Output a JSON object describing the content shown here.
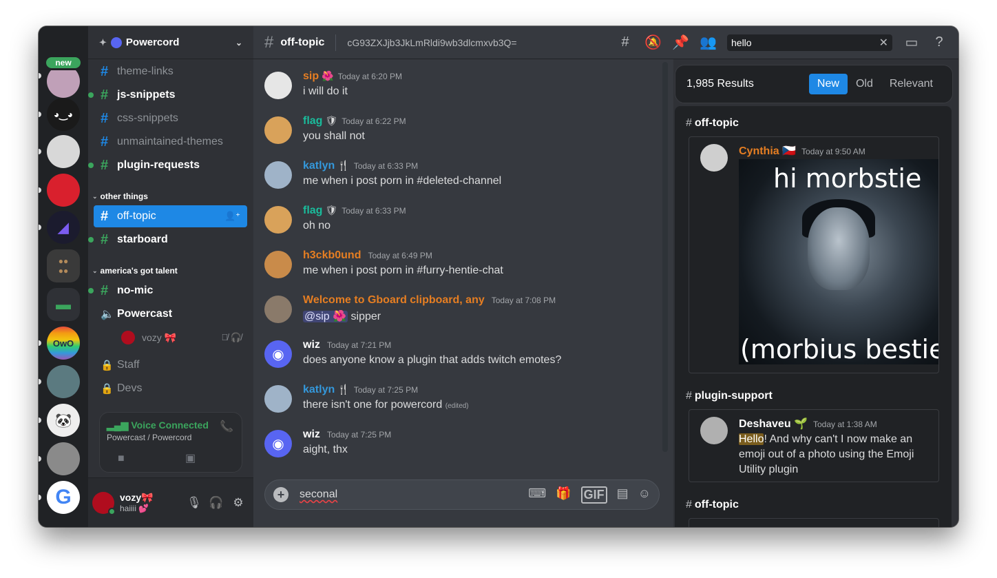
{
  "app": {
    "name": "Discord"
  },
  "guilds": {
    "new_badge": "new",
    "items": [
      {
        "name": "server-avatar-1",
        "color": "#c0a0b8"
      },
      {
        "name": "server-avatar-2",
        "color": "#1a1a1a"
      },
      {
        "name": "server-avatar-3",
        "color": "#d8d8d8"
      },
      {
        "name": "server-avatar-4",
        "color": "#d9202d"
      },
      {
        "name": "powercord-server",
        "color": "#1b1b2e"
      },
      {
        "name": "cookie-folder",
        "color": "#3a3a3a"
      },
      {
        "name": "green-folder",
        "color": "#2f3136"
      },
      {
        "name": "owo-server",
        "color": "#3ba55d"
      },
      {
        "name": "server-avatar-9",
        "color": "#5b7a80"
      },
      {
        "name": "panda-server",
        "color": "#eeeeee"
      },
      {
        "name": "grey-server",
        "color": "#8a8a8a"
      },
      {
        "name": "google-server",
        "color": "#ffffff"
      }
    ]
  },
  "server": {
    "name": "Powercord"
  },
  "channels": {
    "list": [
      {
        "name": "theme-links",
        "type": "text",
        "bright": false,
        "unread": false
      },
      {
        "name": "js-snippets",
        "type": "text",
        "bright": true,
        "unread": true
      },
      {
        "name": "css-snippets",
        "type": "text",
        "bright": false,
        "unread": false
      },
      {
        "name": "unmaintained-themes",
        "type": "text",
        "bright": false,
        "unread": false
      },
      {
        "name": "plugin-requests",
        "type": "text",
        "bright": true,
        "unread": true
      }
    ],
    "category_other": "other things",
    "other": [
      {
        "name": "off-topic",
        "type": "text",
        "active": true
      },
      {
        "name": "starboard",
        "type": "text",
        "bright": true,
        "unread": true
      }
    ],
    "category_agt": "america's got talent",
    "agt": [
      {
        "name": "no-mic",
        "type": "text",
        "bright": true,
        "unread": true
      },
      {
        "name": "Powercast",
        "type": "voice",
        "bright": true
      }
    ],
    "voice_user": "vozy 🎀",
    "locked": [
      {
        "name": "Staff",
        "type": "locked"
      },
      {
        "name": "Devs",
        "type": "locked"
      }
    ]
  },
  "voice_connected": {
    "title": "Voice Connected",
    "subtitle": "Powercast / Powercord"
  },
  "user": {
    "name": "vozy🎀",
    "status": "haiiii 💕"
  },
  "topbar": {
    "channel": "off-topic",
    "topic": "cG93ZXJjb3JkLmRldi9wb3dlcmxvb3Q=",
    "search_value": "hello"
  },
  "messages": [
    {
      "author": "sip",
      "badge": "🌺",
      "color": "#e67e22",
      "time": "Today at 6:20 PM",
      "text": "i will do it",
      "avatar": "#e6e6e6"
    },
    {
      "author": "flag",
      "badge": "🛡",
      "color": "#1abc9c",
      "time": "Today at 6:22 PM",
      "text": "you shall not",
      "avatar": "#d9a25a"
    },
    {
      "author": "katlyn",
      "badge": "🍴",
      "color": "#3498db",
      "time": "Today at 6:33 PM",
      "text": "me when i post porn in #deleted-channel",
      "avatar": "#9fb3c8"
    },
    {
      "author": "flag",
      "badge": "🛡",
      "color": "#1abc9c",
      "time": "Today at 6:33 PM",
      "text": "oh no",
      "avatar": "#d9a25a"
    },
    {
      "author": "h3ckb0und",
      "badge": "",
      "color": "#e67e22",
      "time": "Today at 6:49 PM",
      "text": "me when i post porn in #furry-hentie-chat",
      "avatar": "#c98b4a"
    },
    {
      "author": "Welcome to Gboard clipboard, any",
      "badge": "",
      "color": "#e67e22",
      "time": "Today at 7:08 PM",
      "mention": "@sip 🌺",
      "text": " sipper",
      "avatar": "#8a7a6a"
    },
    {
      "author": "wiz",
      "badge": "",
      "color": "#ffffff",
      "time": "Today at 7:21 PM",
      "text": "does anyone know a plugin that adds twitch emotes?",
      "avatar": "#5865f2"
    },
    {
      "author": "katlyn",
      "badge": "🍴",
      "color": "#3498db",
      "time": "Today at 7:25 PM",
      "text": "there isn't one for powercord",
      "edited": "(edited)",
      "avatar": "#9fb3c8"
    },
    {
      "author": "wiz",
      "badge": "",
      "color": "#ffffff",
      "time": "Today at 7:25 PM",
      "text": "aight, thx",
      "avatar": "#5865f2"
    }
  ],
  "composer": {
    "value": "seconal"
  },
  "search_results": {
    "count": "1,985 Results",
    "sort": [
      "New",
      "Old",
      "Relevant"
    ],
    "groups": [
      {
        "channel": "off-topic",
        "author": "Cynthia 🇨🇿",
        "time": "Today at 9:50 AM",
        "color": "#e67e22",
        "meme_top": "hi morbstie",
        "meme_bottom": "(morbius bestie"
      },
      {
        "channel": "plugin-support",
        "author": "Deshaveu 🌱",
        "time": "Today at 1:38 AM",
        "color": "#ffffff",
        "highlight": "Hello",
        "text": "! And why can't I now make an emoji out of a photo using the Emoji Utility plugin"
      },
      {
        "channel": "off-topic"
      }
    ]
  }
}
